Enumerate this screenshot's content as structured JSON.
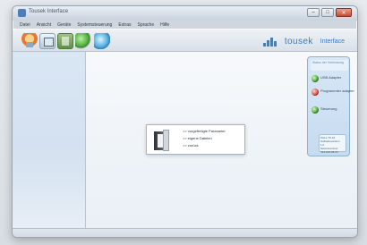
{
  "window": {
    "title": "Tousek Interface",
    "controls": [
      "–",
      "□",
      "✕"
    ]
  },
  "menu": [
    "Datei",
    "Ansicht",
    "Geräte",
    "Systemsteuerung",
    "Extras",
    "Sprache",
    "Hilfe"
  ],
  "brand": {
    "name": "tousek",
    "sub": "Interface"
  },
  "status_panel": {
    "title": "Status der Verbindung",
    "items": [
      {
        "label": "USB Adapter",
        "state": "ok"
      },
      {
        "label": "Programmier adapter",
        "state": "err"
      },
      {
        "label": "Steuerung",
        "state": "ok"
      }
    ],
    "detail": [
      "PULL TS 10",
      "Softwareversion",
      "1.0",
      "Seriennummer",
      "434-200-98-04"
    ]
  },
  "dialog": {
    "options": [
      ">> vorgefertigte Parameter",
      ">> eigene Dateien",
      ">> zurück"
    ]
  },
  "colors": {
    "accent": "#3d7ab8",
    "ok": "#42a22e",
    "error": "#d14b3c"
  }
}
